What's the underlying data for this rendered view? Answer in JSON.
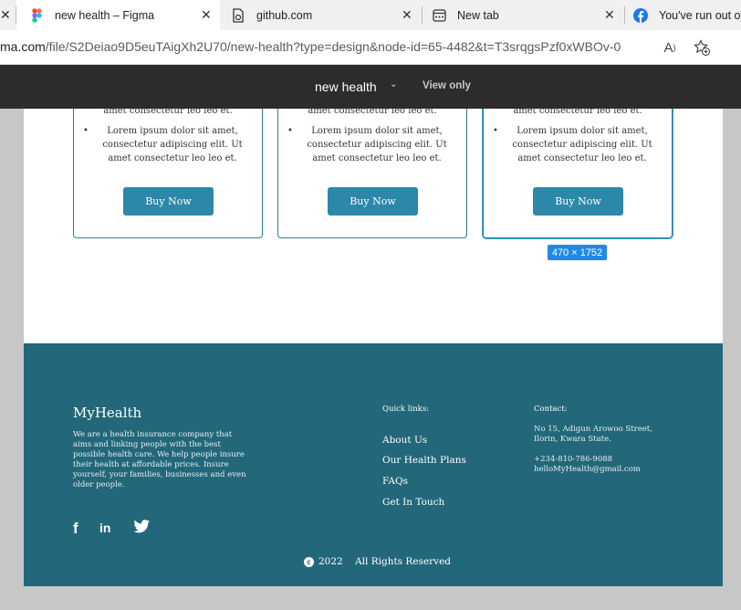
{
  "browser": {
    "tabs": [
      {
        "title": "new health – Figma",
        "icon": "figma-icon",
        "active": true
      },
      {
        "title": "github.com",
        "icon": "github-page-icon",
        "active": false
      },
      {
        "title": "New tab",
        "icon": "new-tab-icon",
        "active": false
      },
      {
        "title": "You've run out of",
        "icon": "facebook-icon",
        "active": false
      }
    ],
    "url_host_fragment": "ma.com",
    "url_path": "/file/S2Deiao9D5euTAigXh2U70/new-health?type=design&node-id=65-4482&t=T3srqgsPzf0xWBOv-0"
  },
  "figma": {
    "file_name": "new health",
    "mode": "View only",
    "selection_size": "470 × 1752"
  },
  "cards": [
    {
      "prev_line": "amet consectetur leo leo et.",
      "bullet": "Lorem ipsum dolor sit amet, consectetur adipiscing elit. Ut amet consectetur leo leo et.",
      "button": "Buy Now"
    },
    {
      "prev_line": "amet consectetur leo leo et.",
      "bullet": "Lorem ipsum dolor sit amet, consectetur adipiscing elit. Ut amet consectetur leo leo et.",
      "button": "Buy Now"
    },
    {
      "prev_line": "amet consectetur leo leo et.",
      "bullet": "Lorem ipsum dolor sit amet, consectetur adipiscing elit. Ut amet consectetur leo leo et.",
      "button": "Buy Now"
    }
  ],
  "footer": {
    "brand": "MyHealth",
    "about": "We are a health insurance company that aims and linking people with the best possible health care. We help people insure their health at affordable prices. Insure yourself, your families, businesses and even older people.",
    "quick_links_title": "Quick links:",
    "quick_links": [
      "About Us",
      "Our Health Plans",
      "FAQs",
      "Get In Touch"
    ],
    "contact_title": "Contact:",
    "address": "No 15, Adigun Arowoo Street, Ilorin, Kwara State.",
    "phone": "+234-810-786-9088",
    "email": "helloMyHealth@gmail.com",
    "copyright_symbol": "c",
    "copyright": "2022    All Rights Reserved",
    "social": [
      "f",
      "in"
    ],
    "colors": {
      "footer_bg": "#23677a",
      "button": "#2d87a9",
      "card_border": "#2c7f96",
      "selection": "#1f8ae6"
    }
  }
}
